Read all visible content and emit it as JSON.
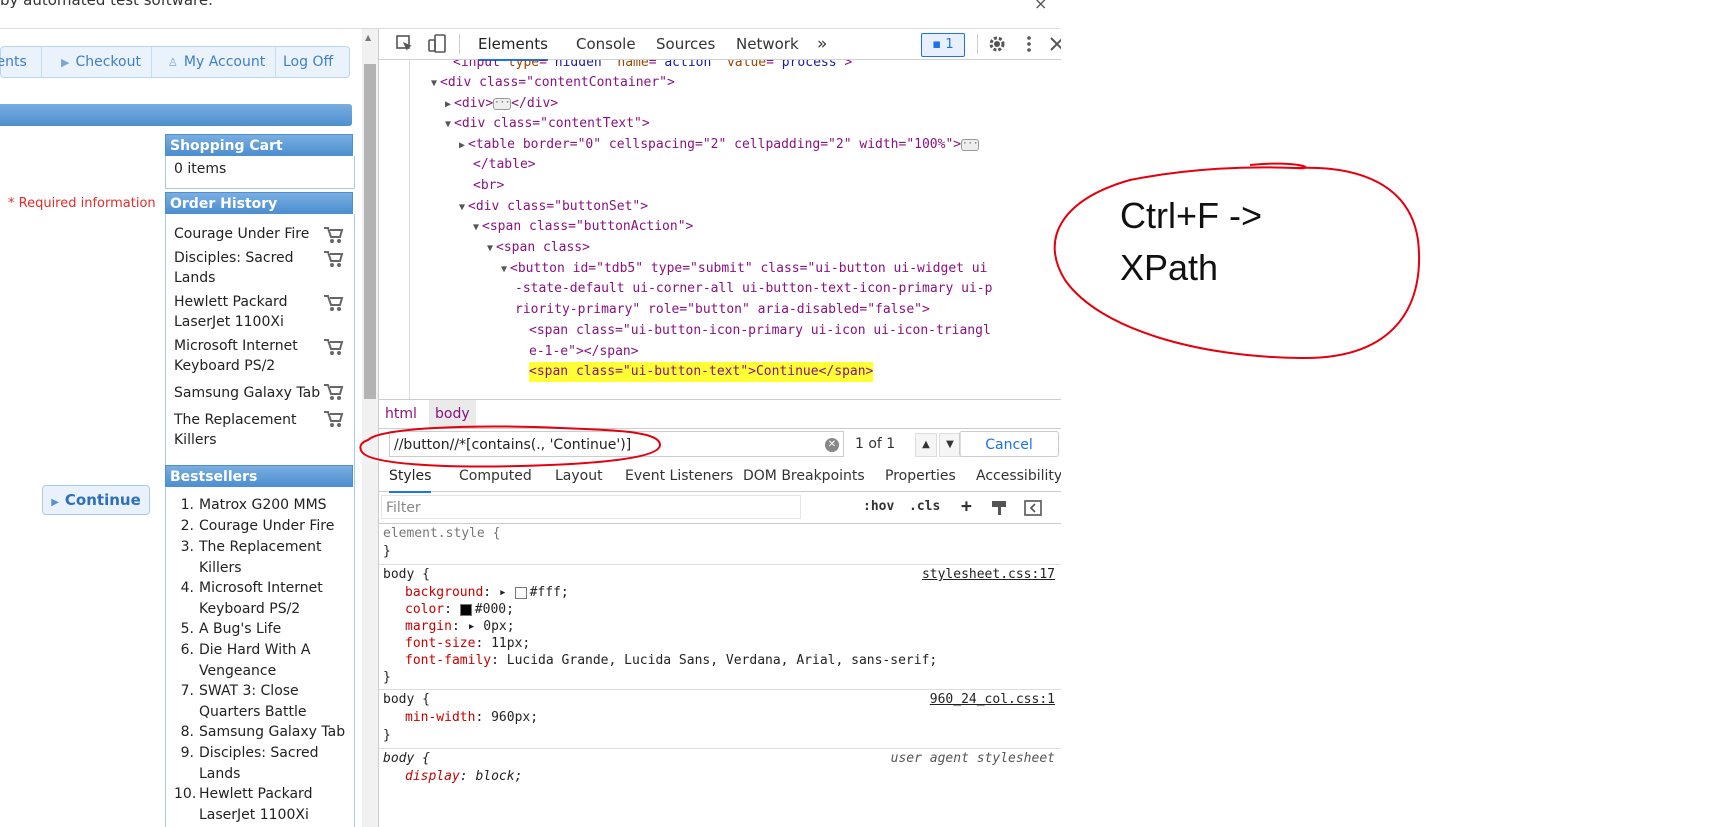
{
  "infobar": {
    "text": "by automated test software.",
    "close": "×"
  },
  "web": {
    "nav": [
      {
        "label": "tents",
        "icon": ""
      },
      {
        "label": "Checkout",
        "icon": "arrow-right-icon"
      },
      {
        "label": "My Account",
        "icon": "person-icon"
      },
      {
        "label": "Log Off",
        "icon": ""
      }
    ],
    "required_text": "* Required information",
    "continue_button": "Continue",
    "shopping_cart": {
      "title": "Shopping Cart",
      "items": "0 items"
    },
    "order_history": {
      "title": "Order History",
      "items": [
        "Courage Under Fire",
        "Disciples: Sacred Lands",
        "Hewlett Packard LaserJet 1100Xi",
        "Microsoft Internet Keyboard PS/2",
        "Samsung Galaxy Tab",
        "The Replacement Killers"
      ]
    },
    "bestsellers": {
      "title": "Bestsellers",
      "items": [
        {
          "num": "1.",
          "name": "Matrox G200 MMS"
        },
        {
          "num": "2.",
          "name": "Courage Under Fire"
        },
        {
          "num": "3.",
          "name": "The Replacement Killers"
        },
        {
          "num": "4.",
          "name": "Microsoft Internet Keyboard PS/2"
        },
        {
          "num": "5.",
          "name": "A Bug's Life"
        },
        {
          "num": "6.",
          "name": "Die Hard With A Vengeance"
        },
        {
          "num": "7.",
          "name": "SWAT 3: Close Quarters Battle"
        },
        {
          "num": "8.",
          "name": "Samsung Galaxy Tab"
        },
        {
          "num": "9.",
          "name": "Disciples: Sacred Lands"
        },
        {
          "num": "10.",
          "name": "Hewlett Packard LaserJet 1100Xi"
        }
      ]
    }
  },
  "devtools": {
    "tabs": [
      "Elements",
      "Console",
      "Sources",
      "Network"
    ],
    "more_tabs": "»",
    "issues_badge": "1",
    "dom": {
      "l1": [
        "<input ",
        "type",
        "=\"",
        "hidden",
        "\" ",
        "name",
        "=\"",
        "action",
        "\" ",
        "value",
        "=\"",
        "process",
        "\">"
      ],
      "l2": "<div class=\"contentContainer\">",
      "l3": "<div>",
      "l3b": "</div>",
      "l4": "<div class=\"contentText\">",
      "l5": "<table border=\"0\" cellspacing=\"2\" cellpadding=\"2\" width=\"100%\">",
      "l6": "</table>",
      "l7": "<br>",
      "l8": "<div class=\"buttonSet\">",
      "l9": "<span class=\"buttonAction\">",
      "l10": "<span class>",
      "l11": "<button id=\"tdb5\" type=\"submit\" class=\"ui-button ui-widget ui",
      "l12": "-state-default ui-corner-all ui-button-text-icon-primary ui-p",
      "l13": "riority-primary\" role=\"button\" aria-disabled=\"false\">",
      "l14": "<span class=\"ui-button-icon-primary ui-icon ui-icon-triangl",
      "l15": "e-1-e\"></span>",
      "l16": "<span class=\"ui-button-text\">Continue</span>"
    },
    "breadcrumbs": [
      "html",
      "body"
    ],
    "search": {
      "query": "//button//*[contains(., 'Continue')]",
      "count": "1 of 1",
      "cancel": "Cancel"
    },
    "style_tabs": [
      "Styles",
      "Computed",
      "Layout",
      "Event Listeners",
      "DOM Breakpoints",
      "Properties",
      "Accessibility"
    ],
    "filter": {
      "placeholder": "Filter",
      "hov": ":hov",
      "cls": ".cls",
      "plus": "+"
    },
    "rules": {
      "r1": {
        "selector": "element.style {",
        "close": "}"
      },
      "r2": {
        "selector": "body {",
        "source": "stylesheet.css:17",
        "props": [
          {
            "name": "background",
            "value": "#fff;",
            "swatch": "#ffffff"
          },
          {
            "name": "color",
            "value": "#000;",
            "swatch": "#000000"
          },
          {
            "name": "margin",
            "value": "0px;"
          },
          {
            "name": "font-size",
            "value": "11px;"
          },
          {
            "name": "font-family",
            "value": "Lucida Grande, Lucida Sans, Verdana, Arial, sans-serif;"
          }
        ],
        "close": "}"
      },
      "r3": {
        "selector": "body {",
        "source": "960_24_col.css:1",
        "props": [
          {
            "name": "min-width",
            "value": "960px;"
          }
        ],
        "close": "}"
      },
      "r4": {
        "selector": "body {",
        "source": "user agent stylesheet",
        "props": [
          {
            "name": "display",
            "value": "block;"
          }
        ]
      }
    }
  },
  "annotation": {
    "text": "Ctrl+F ->\nXPath",
    "color": "#e3000f"
  }
}
